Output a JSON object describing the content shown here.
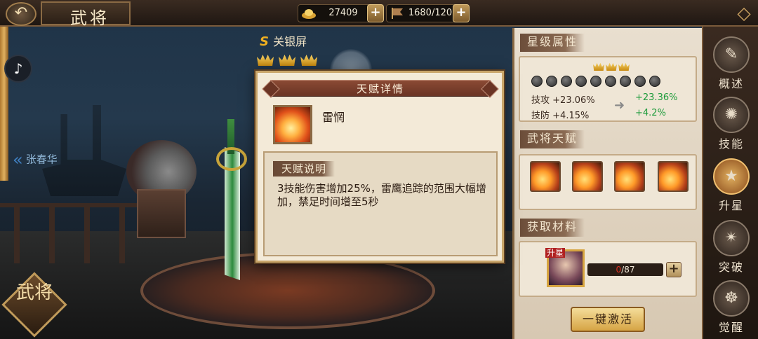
{
  "topbar": {
    "title": "武将",
    "coins": "27409",
    "stamina": "1680/120",
    "back_icon": "back-arrow-icon",
    "menu_icon": "corner-menu-icon"
  },
  "left": {
    "prev_hero": "张春华",
    "badge": "武将",
    "tiktok_icon": "tiktok-icon"
  },
  "hero": {
    "grade": "S",
    "name": "关银屏",
    "crowns": 3
  },
  "modal": {
    "title": "天赋详情",
    "skill_name": "雷惘",
    "desc_label": "天赋说明",
    "desc_text": "3技能伤害增加25%，雷鹰追踪的范围大幅增加，禁足时间增至5秒"
  },
  "rpanel": {
    "star_title": "星级属性",
    "star_crowns": 3,
    "dots_count": 9,
    "attrs": [
      {
        "label": "技攻",
        "value": "+23.06%",
        "new": "+23.36%"
      },
      {
        "label": "技防",
        "value": "+4.15%",
        "new": "+4.2%"
      }
    ],
    "talent_title": "武将天赋",
    "material_title": "获取材料",
    "material_tag": "升星",
    "material_count_cur": "0",
    "material_count_total": "/87",
    "activate_label": "一键激活"
  },
  "vmenu": [
    {
      "label": "概述",
      "icon": "book-icon",
      "active": false
    },
    {
      "label": "技能",
      "icon": "skill-icon",
      "active": false
    },
    {
      "label": "升星",
      "icon": "star-icon",
      "active": true
    },
    {
      "label": "突破",
      "icon": "breakthrough-icon",
      "active": false
    },
    {
      "label": "觉醒",
      "icon": "awaken-icon",
      "active": false
    }
  ],
  "colors": {
    "accent_gold": "#c9a66a",
    "green_new": "#1d9b3b",
    "red_count": "#e03020"
  }
}
